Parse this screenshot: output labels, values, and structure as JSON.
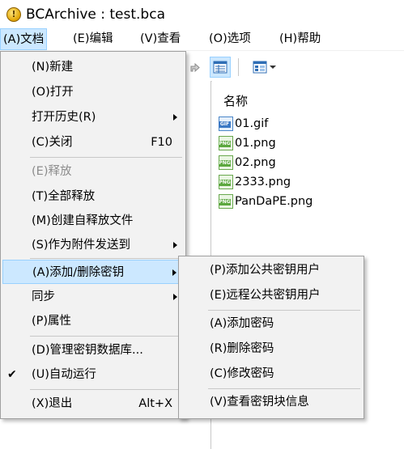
{
  "window": {
    "title": "BCArchive : test.bca",
    "icon": "key-icon",
    "icon_glyph": "!"
  },
  "menubar": [
    {
      "label": "(A)文档",
      "active": true
    },
    {
      "label": "(E)编辑"
    },
    {
      "label": "(V)查看"
    },
    {
      "label": "(O)选项"
    },
    {
      "label": "(H)帮助"
    }
  ],
  "file_list": {
    "column_name": "名称",
    "files": [
      {
        "name": "01.gif",
        "type": "gif",
        "tag": "GIF"
      },
      {
        "name": "01.png",
        "type": "png",
        "tag": "PNG"
      },
      {
        "name": "02.png",
        "type": "png",
        "tag": "PNG"
      },
      {
        "name": "2333.png",
        "type": "png",
        "tag": "PNG"
      },
      {
        "name": "PanDaPE.png",
        "type": "png",
        "tag": "PNG"
      }
    ]
  },
  "document_menu": {
    "items": [
      {
        "label": "(N)新建"
      },
      {
        "label": "(O)打开"
      },
      {
        "label": "打开历史(R)",
        "submenu": true
      },
      {
        "label": "(C)关闭",
        "shortcut": "F10"
      },
      {
        "label": "(E)释放",
        "disabled": true
      },
      {
        "label": "(T)全部释放"
      },
      {
        "label": "(M)创建自释放文件"
      },
      {
        "label": "(S)作为附件发送到",
        "submenu": true
      },
      {
        "label": "(A)添加/删除密钥",
        "submenu": true,
        "highlight": true
      },
      {
        "label": "同步",
        "submenu": true
      },
      {
        "label": "(P)属性"
      },
      {
        "label": "(D)管理密钥数据库..."
      },
      {
        "label": "(U)自动运行",
        "checked": true,
        "check_glyph": "✔"
      },
      {
        "label": "(X)退出",
        "shortcut": "Alt+X"
      }
    ]
  },
  "key_submenu": {
    "items": [
      {
        "label": "(P)添加公共密钥用户"
      },
      {
        "label": "(E)远程公共密钥用户"
      },
      {
        "label": "(A)添加密码"
      },
      {
        "label": "(R)删除密码"
      },
      {
        "label": "(C)修改密码"
      },
      {
        "label": "(V)查看密钥块信息"
      }
    ]
  }
}
